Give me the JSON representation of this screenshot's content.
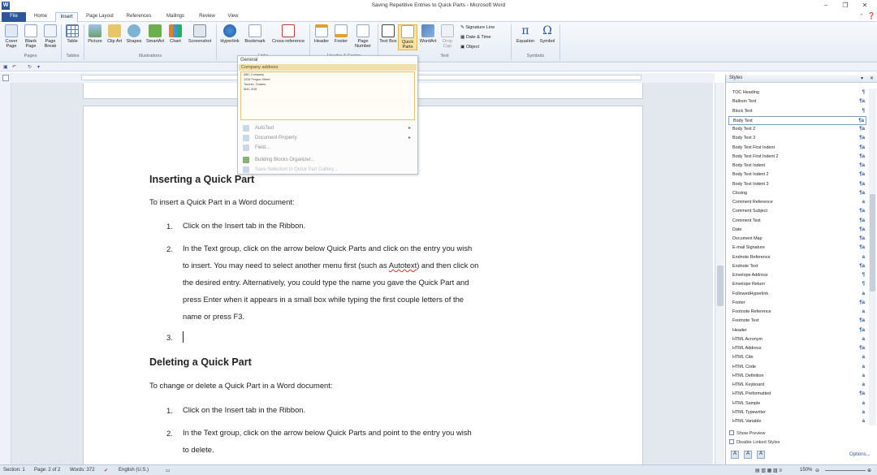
{
  "window": {
    "title": "Saving Repetitive Entries to Quick Parts - Microsoft Word",
    "minimize": "–",
    "restore": "❐",
    "close": "✕",
    "app_icon": "W"
  },
  "tabs": [
    "File",
    "Home",
    "Insert",
    "Page Layout",
    "References",
    "Mailings",
    "Review",
    "View"
  ],
  "ribbon": {
    "buttons": [
      "Cover Page",
      "Blank Page",
      "Page Break",
      "Table",
      "Picture",
      "Clip Art",
      "Shapes",
      "SmartArt",
      "Chart",
      "Screenshot",
      "Hyperlink",
      "Bookmark",
      "Cross-reference",
      "Header",
      "Footer",
      "Page Number",
      "Text Box",
      "Quick Parts",
      "WordArt",
      "Drop Cap",
      "Equation",
      "Symbol"
    ],
    "small": [
      "Signature Line",
      "Date & Time",
      "Object"
    ],
    "groups": [
      "Pages",
      "Tables",
      "Illustrations",
      "Links",
      "Header & Footer",
      "Text",
      "Symbols"
    ]
  },
  "quick_parts_menu": {
    "general": "General",
    "category": "Company address",
    "entry_lines": [
      "ABC Company",
      "1234 Fergus Street",
      "Toronto, Ontario",
      "M4C 2G8"
    ],
    "items": [
      "AutoText",
      "Document Property",
      "Field...",
      "Building Blocks Organizer...",
      "Save Selection to Quick Part Gallery..."
    ]
  },
  "document": {
    "h1": "Inserting a Quick Part",
    "p1": "To insert a Quick Part in a Word document:",
    "list1": [
      {
        "n": "1.",
        "lines": [
          "Click on the Insert tab in the Ribbon."
        ]
      },
      {
        "n": "2.",
        "lines": [
          "In the Text group, click on the arrow below Quick Parts and click on the entry you wish",
          "to insert. You may need to select another menu first (such as Autotext) and then click on",
          "the desired entry. Alternatively, you could type the name you gave the Quick Part and",
          "press Enter when it appears in a small box while typing the first couple letters of the",
          "name or press F3."
        ]
      },
      {
        "n": "3.",
        "lines": [
          ""
        ]
      }
    ],
    "h2": "Deleting a Quick Part",
    "p2": "To change or delete a Quick Part in a Word document:",
    "list2": [
      {
        "n": "1.",
        "lines": [
          "Click on the Insert tab in the Ribbon."
        ]
      },
      {
        "n": "2.",
        "lines": [
          "In the Text group, click on the arrow below Quick Parts and point to the entry you wish",
          "to delete."
        ]
      }
    ]
  },
  "styles_pane": {
    "title": "Styles",
    "items": [
      {
        "name": "TOC Heading",
        "mark": "¶"
      },
      {
        "name": "Balloon Text",
        "mark": "¶a"
      },
      {
        "name": "Block Text",
        "mark": "¶"
      },
      {
        "name": "Body Text",
        "mark": "¶a"
      },
      {
        "name": "Body Text 2",
        "mark": "¶a"
      },
      {
        "name": "Body Text 3",
        "mark": "¶a"
      },
      {
        "name": "Body Text First Indent",
        "mark": "¶a"
      },
      {
        "name": "Body Text First Indent 2",
        "mark": "¶a"
      },
      {
        "name": "Body Text Indent",
        "mark": "¶a"
      },
      {
        "name": "Body Text Indent 2",
        "mark": "¶a"
      },
      {
        "name": "Body Text Indent 3",
        "mark": "¶a"
      },
      {
        "name": "Closing",
        "mark": "¶a"
      },
      {
        "name": "Comment Reference",
        "mark": "a"
      },
      {
        "name": "Comment Subject",
        "mark": "¶a"
      },
      {
        "name": "Comment Text",
        "mark": "¶a"
      },
      {
        "name": "Date",
        "mark": "¶a"
      },
      {
        "name": "Document Map",
        "mark": "¶a"
      },
      {
        "name": "E-mail Signature",
        "mark": "¶a"
      },
      {
        "name": "Endnote Reference",
        "mark": "a"
      },
      {
        "name": "Endnote Text",
        "mark": "¶a"
      },
      {
        "name": "Envelope Address",
        "mark": "¶"
      },
      {
        "name": "Envelope Return",
        "mark": "¶"
      },
      {
        "name": "FollowedHyperlink",
        "mark": "a"
      },
      {
        "name": "Footer",
        "mark": "¶a"
      },
      {
        "name": "Footnote Reference",
        "mark": "a"
      },
      {
        "name": "Footnote Text",
        "mark": "¶a"
      },
      {
        "name": "Header",
        "mark": "¶a"
      },
      {
        "name": "HTML Acronym",
        "mark": "a"
      },
      {
        "name": "HTML Address",
        "mark": "¶a"
      },
      {
        "name": "HTML Cite",
        "mark": "a"
      },
      {
        "name": "HTML Code",
        "mark": "a"
      },
      {
        "name": "HTML Definition",
        "mark": "a"
      },
      {
        "name": "HTML Keyboard",
        "mark": "a"
      },
      {
        "name": "HTML Preformatted",
        "mark": "¶a"
      },
      {
        "name": "HTML Sample",
        "mark": "a"
      },
      {
        "name": "HTML Typewriter",
        "mark": "a"
      },
      {
        "name": "HTML Variable",
        "mark": "a"
      }
    ],
    "selected": "Body Text",
    "show_preview": "Show Preview",
    "disable_linked": "Disable Linked Styles",
    "options": "Options..."
  },
  "status": {
    "section": "Section: 1",
    "page": "Page: 2 of 2",
    "words": "Words: 372",
    "lang": "English (U.S.)",
    "zoom": "150%"
  }
}
